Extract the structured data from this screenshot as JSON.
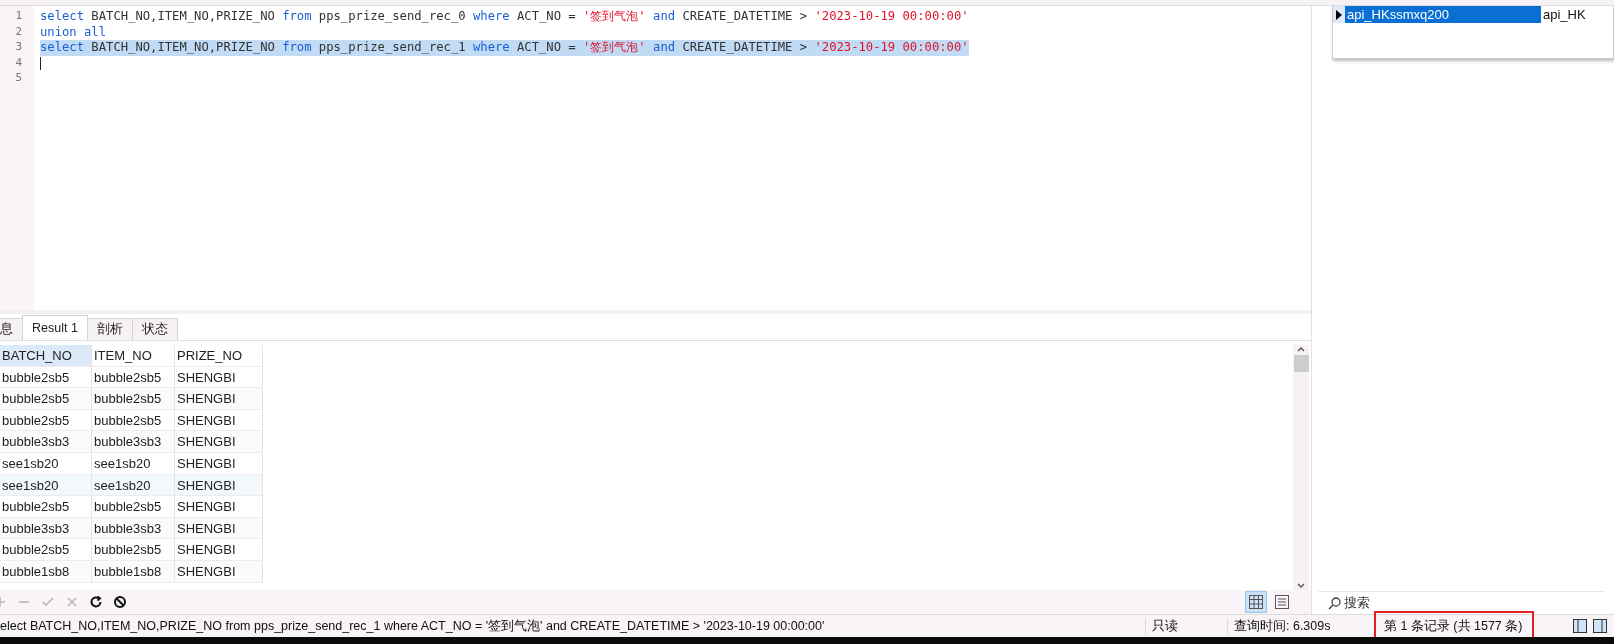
{
  "editor": {
    "lines": [
      {
        "number": "1",
        "selected": false,
        "tokens": [
          {
            "kind": "keyword",
            "text": "select"
          },
          {
            "kind": "plain",
            "text": " BATCH_NO,ITEM_NO,PRIZE_NO "
          },
          {
            "kind": "keyword",
            "text": "from"
          },
          {
            "kind": "plain",
            "text": " pps_prize_send_rec_0 "
          },
          {
            "kind": "keyword",
            "text": "where"
          },
          {
            "kind": "plain",
            "text": " ACT_NO = "
          },
          {
            "kind": "string",
            "text": "'签到气泡'"
          },
          {
            "kind": "keyword",
            "text": " and"
          },
          {
            "kind": "plain",
            "text": " CREATE_DATETIME > "
          },
          {
            "kind": "string",
            "text": "'2023-10-19 00:00:00'"
          }
        ]
      },
      {
        "number": "2",
        "selected": false,
        "tokens": [
          {
            "kind": "keyword",
            "text": "union all"
          }
        ]
      },
      {
        "number": "3",
        "selected": true,
        "tokens": [
          {
            "kind": "keyword",
            "text": "select"
          },
          {
            "kind": "plain",
            "text": " BATCH_NO,ITEM_NO,PRIZE_NO "
          },
          {
            "kind": "keyword",
            "text": "from"
          },
          {
            "kind": "plain",
            "text": " pps_prize_send_rec_1 "
          },
          {
            "kind": "keyword",
            "text": "where"
          },
          {
            "kind": "plain",
            "text": " ACT_NO = "
          },
          {
            "kind": "string",
            "text": "'签到气泡'"
          },
          {
            "kind": "keyword",
            "text": " and"
          },
          {
            "kind": "plain",
            "text": " CREATE_DATETIME > "
          },
          {
            "kind": "string",
            "text": "'2023-10-19 00:00:00'"
          }
        ]
      },
      {
        "number": "4"
      },
      {
        "number": "5"
      }
    ]
  },
  "result_tabs": [
    {
      "label": "息",
      "selected": false
    },
    {
      "label": "Result 1",
      "selected": true
    },
    {
      "label": "剖析",
      "selected": false
    },
    {
      "label": "状态",
      "selected": false
    }
  ],
  "table": {
    "columns": [
      {
        "label": "BATCH_NO",
        "selected": true
      },
      {
        "label": "ITEM_NO",
        "selected": false
      },
      {
        "label": "PRIZE_NO",
        "selected": false
      }
    ],
    "rows": [
      [
        "bubble2sb5",
        "bubble2sb5",
        "SHENGBI"
      ],
      [
        "bubble2sb5",
        "bubble2sb5",
        "SHENGBI"
      ],
      [
        "bubble2sb5",
        "bubble2sb5",
        "SHENGBI"
      ],
      [
        "bubble3sb3",
        "bubble3sb3",
        "SHENGBI"
      ],
      [
        "see1sb20",
        "see1sb20",
        "SHENGBI"
      ],
      [
        "see1sb20",
        "see1sb20",
        "SHENGBI"
      ],
      [
        "bubble2sb5",
        "bubble2sb5",
        "SHENGBI"
      ],
      [
        "bubble3sb3",
        "bubble3sb3",
        "SHENGBI"
      ],
      [
        "bubble2sb5",
        "bubble2sb5",
        "SHENGBI"
      ],
      [
        "bubble1sb8",
        "bubble1sb8",
        "SHENGBI"
      ]
    ]
  },
  "toolbar": [
    {
      "kind": "plus",
      "disabled": true
    },
    {
      "kind": "minus",
      "disabled": true
    },
    {
      "kind": "check",
      "disabled": true
    },
    {
      "kind": "cross",
      "disabled": true
    },
    {
      "kind": "refresh",
      "disabled": false
    },
    {
      "kind": "stop",
      "disabled": false
    }
  ],
  "view_modes": [
    {
      "kind": "grid",
      "selected": true
    },
    {
      "kind": "form",
      "selected": false
    }
  ],
  "connection_popup": {
    "rows": [
      {
        "cells": [
          "api_HKssmxq200",
          "api_HK"
        ],
        "selected": true
      }
    ]
  },
  "search": {
    "placeholder": "搜索"
  },
  "status_bar": {
    "sql": "elect BATCH_NO,ITEM_NO,PRIZE_NO from pps_prize_send_rec_1 where ACT_NO = '签到气泡' and CREATE_DATETIME > '2023-10-19 00:00:00'",
    "mode": "只读",
    "query_time": "查询时间: 6.309s",
    "record": "第 1 条记录 (共 1577 条)",
    "record_highlighted": true
  }
}
